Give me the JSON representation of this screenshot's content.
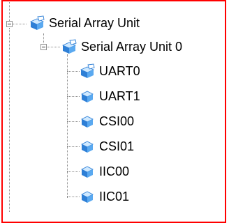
{
  "tree": {
    "root": {
      "label": "Serial Array Unit",
      "icon": "blue-cube-folder-icon",
      "expanded": true,
      "children": [
        {
          "label": "Serial Array Unit 0",
          "icon": "blue-cube-folder-icon",
          "expanded": true,
          "children": [
            {
              "label": "UART0",
              "icon": "blue-cube-folder-icon"
            },
            {
              "label": "UART1",
              "icon": "blue-cube-icon"
            },
            {
              "label": "CSI00",
              "icon": "blue-cube-icon"
            },
            {
              "label": "CSI01",
              "icon": "blue-cube-icon"
            },
            {
              "label": "IIC00",
              "icon": "blue-cube-icon"
            },
            {
              "label": "IIC01",
              "icon": "blue-cube-icon"
            }
          ]
        }
      ]
    }
  },
  "colors": {
    "frame": "#ff0000",
    "connector": "#8a8a8a",
    "cube_top": "#cfe9ff",
    "cube_left": "#2e7fd6",
    "cube_right": "#5aa9f0"
  }
}
